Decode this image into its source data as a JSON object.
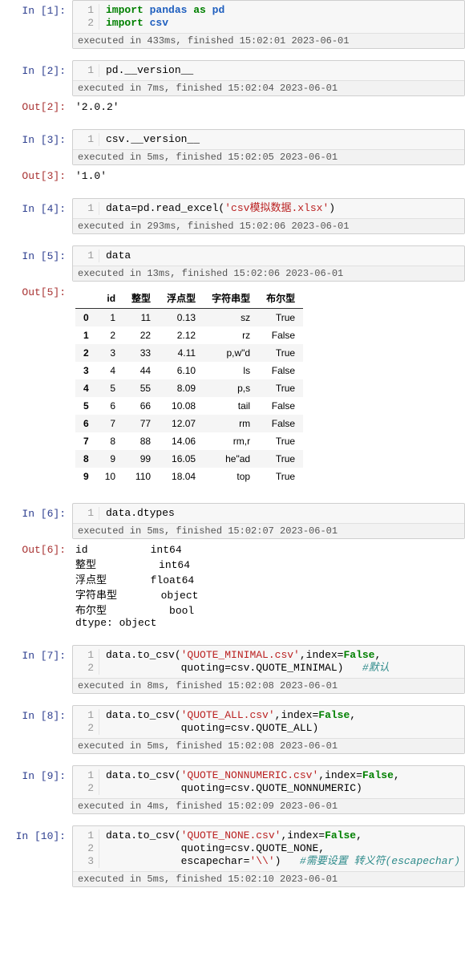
{
  "cells": {
    "c1": {
      "prompt": "In [1]:",
      "gutter": [
        "1",
        "2"
      ],
      "exec": "executed in 433ms, finished 15:02:01 2023-06-01"
    },
    "c2": {
      "prompt": "In [2]:",
      "gutter": [
        "1"
      ],
      "code": "pd.__version__",
      "exec": "executed in 7ms, finished 15:02:04 2023-06-01",
      "out_prompt": "Out[2]:",
      "out": "'2.0.2'"
    },
    "c3": {
      "prompt": "In [3]:",
      "gutter": [
        "1"
      ],
      "code": "csv.__version__",
      "exec": "executed in 5ms, finished 15:02:05 2023-06-01",
      "out_prompt": "Out[3]:",
      "out": "'1.0'"
    },
    "c4": {
      "prompt": "In [4]:",
      "gutter": [
        "1"
      ],
      "exec": "executed in 293ms, finished 15:02:06 2023-06-01"
    },
    "c5": {
      "prompt": "In [5]:",
      "gutter": [
        "1"
      ],
      "code": "data",
      "exec": "executed in 13ms, finished 15:02:06 2023-06-01",
      "out_prompt": "Out[5]:"
    },
    "c6": {
      "prompt": "In [6]:",
      "gutter": [
        "1"
      ],
      "code": "data.dtypes",
      "exec": "executed in 5ms, finished 15:02:07 2023-06-01",
      "out_prompt": "Out[6]:",
      "out": "id          int64\n整型          int64\n浮点型       float64\n字符串型       object\n布尔型          bool\ndtype: object"
    },
    "c7": {
      "prompt": "In [7]:",
      "gutter": [
        "1",
        "2"
      ],
      "exec": "executed in 8ms, finished 15:02:08 2023-06-01"
    },
    "c8": {
      "prompt": "In [8]:",
      "gutter": [
        "1",
        "2"
      ],
      "exec": "executed in 5ms, finished 15:02:08 2023-06-01"
    },
    "c9": {
      "prompt": "In [9]:",
      "gutter": [
        "1",
        "2"
      ],
      "exec": "executed in 4ms, finished 15:02:09 2023-06-01"
    },
    "c10": {
      "prompt": "In [10]:",
      "gutter": [
        "1",
        "2",
        "3"
      ],
      "exec": "executed in 5ms, finished 15:02:10 2023-06-01"
    }
  },
  "table": {
    "headers": [
      "",
      "id",
      "整型",
      "浮点型",
      "字符串型",
      "布尔型"
    ],
    "rows": [
      [
        "0",
        "1",
        "11",
        "0.13",
        "sz",
        "True"
      ],
      [
        "1",
        "2",
        "22",
        "2.12",
        "rz",
        "False"
      ],
      [
        "2",
        "3",
        "33",
        "4.11",
        "p,w\"d",
        "True"
      ],
      [
        "3",
        "4",
        "44",
        "6.10",
        "ls",
        "False"
      ],
      [
        "4",
        "5",
        "55",
        "8.09",
        "p,s",
        "True"
      ],
      [
        "5",
        "6",
        "66",
        "10.08",
        "tail",
        "False"
      ],
      [
        "6",
        "7",
        "77",
        "12.07",
        "rm",
        "False"
      ],
      [
        "7",
        "8",
        "88",
        "14.06",
        "rm,r",
        "True"
      ],
      [
        "8",
        "9",
        "99",
        "16.05",
        "he\"ad",
        "True"
      ],
      [
        "9",
        "10",
        "110",
        "18.04",
        "top",
        "True"
      ]
    ]
  },
  "code_strings": {
    "import_pandas_kw": "import",
    "pandas": "pandas",
    "as": "as",
    "pd": "pd",
    "import_csv_kw": "import",
    "csv": "csv",
    "read_excel_pre": "data=pd.read_excel(",
    "read_excel_str": "'csv模拟数据.xlsx'",
    "read_excel_post": ")",
    "c7l1_a": "data.to_csv(",
    "c7l1_s": "'QUOTE_MINIMAL.csv'",
    "c7l1_b": ",index=",
    "c7l1_false": "False",
    "c7l1_c": ",",
    "c7l2_a": "            quoting=csv.QUOTE_MINIMAL)   ",
    "c7l2_comment": "#默认",
    "c8l1_a": "data.to_csv(",
    "c8l1_s": "'QUOTE_ALL.csv'",
    "c8l1_b": ",index=",
    "c8l1_false": "False",
    "c8l1_c": ",",
    "c8l2_a": "            quoting=csv.QUOTE_ALL)",
    "c9l1_a": "data.to_csv(",
    "c9l1_s": "'QUOTE_NONNUMERIC.csv'",
    "c9l1_b": ",index=",
    "c9l1_false": "False",
    "c9l1_c": ",",
    "c9l2_a": "            quoting=csv.QUOTE_NONNUMERIC)",
    "c10l1_a": "data.to_csv(",
    "c10l1_s": "'QUOTE_NONE.csv'",
    "c10l1_b": ",index=",
    "c10l1_false": "False",
    "c10l1_c": ",",
    "c10l2_a": "            quoting=csv.QUOTE_NONE,",
    "c10l3_a": "            escapechar=",
    "c10l3_s": "'\\\\'",
    "c10l3_b": ")   ",
    "c10l3_comment": "#需要设置 转义符(escapechar)"
  }
}
